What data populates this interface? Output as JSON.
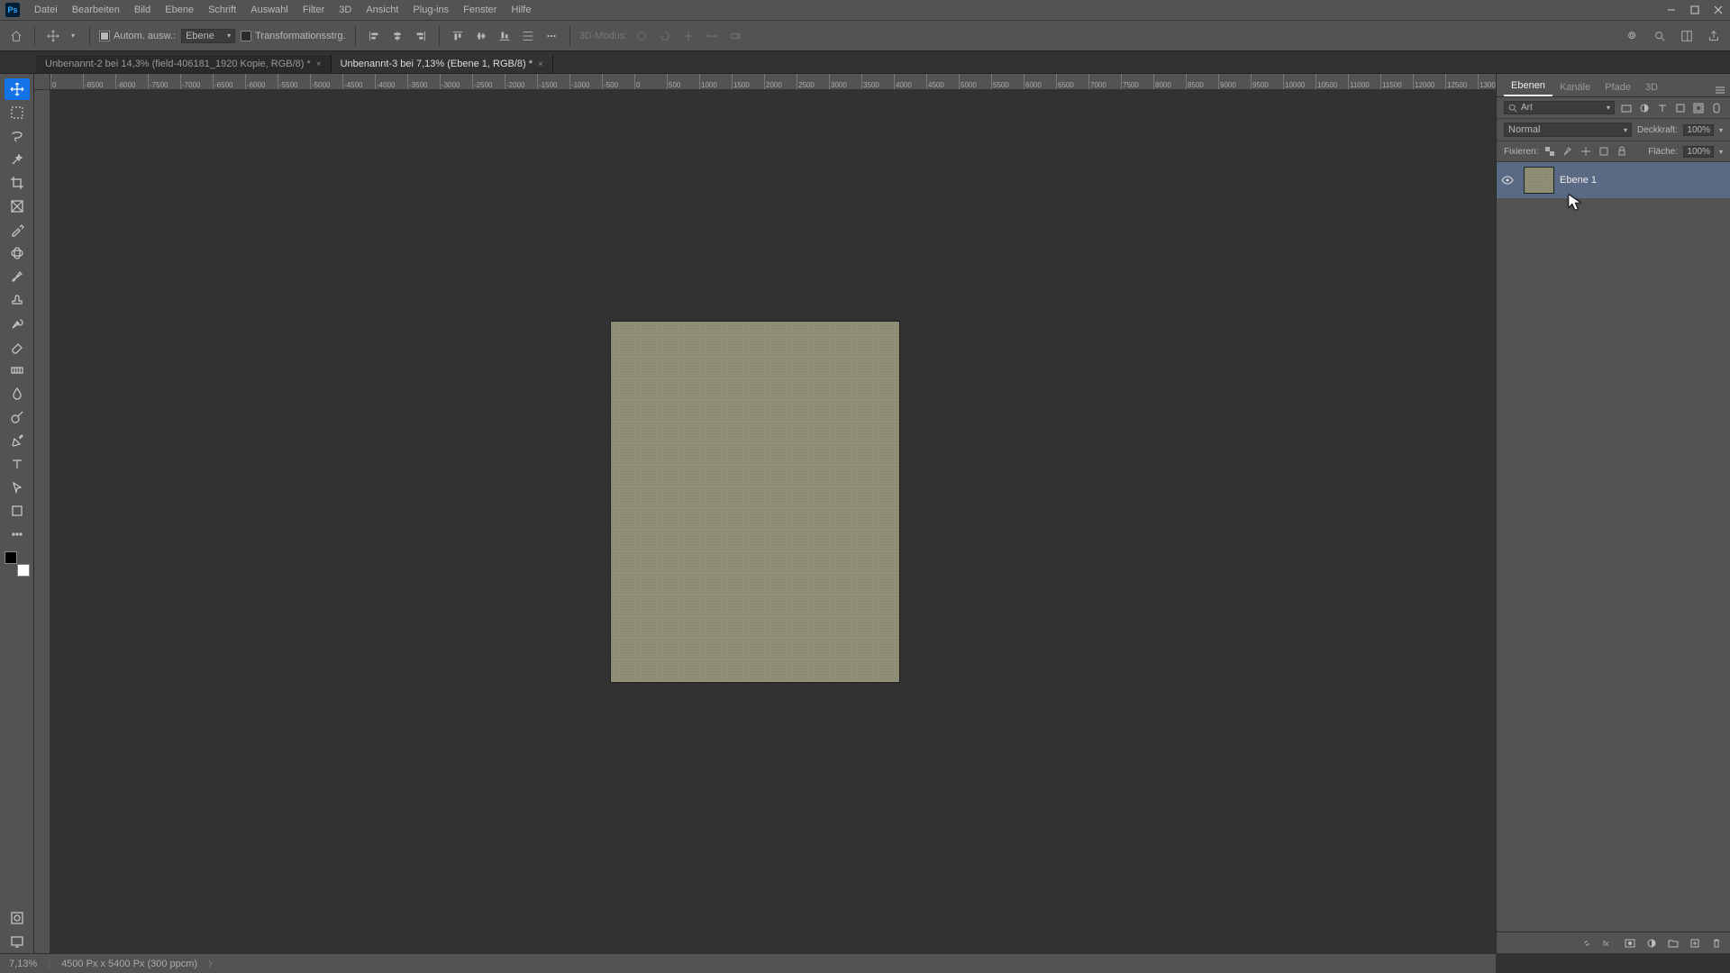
{
  "menu": [
    "Datei",
    "Bearbeiten",
    "Bild",
    "Ebene",
    "Schrift",
    "Auswahl",
    "Filter",
    "3D",
    "Ansicht",
    "Plug-ins",
    "Fenster",
    "Hilfe"
  ],
  "logo": "Ps",
  "optbar": {
    "auto_label": "Autom. ausw.:",
    "target_dropdown": "Ebene",
    "transform_label": "Transformationsstrg.",
    "mode3d": "3D-Modus:"
  },
  "tabs": [
    {
      "label": "Unbenannt-2 bei 14,3% (field-406181_1920 Kopie, RGB/8) *",
      "active": false
    },
    {
      "label": "Unbenannt-3 bei 7,13% (Ebene 1, RGB/8) *",
      "active": true
    }
  ],
  "ruler_h": [
    "0",
    "-8500",
    "-8000",
    "-7500",
    "-7000",
    "-6500",
    "-6000",
    "-5500",
    "-5000",
    "-4500",
    "-4000",
    "-3500",
    "-3000",
    "-2500",
    "-2000",
    "-1500",
    "-1000",
    "-500",
    "0",
    "500",
    "1000",
    "1500",
    "2000",
    "2500",
    "3000",
    "3500",
    "4000",
    "4500",
    "5000",
    "5500",
    "6000",
    "6500",
    "7000",
    "7500",
    "8000",
    "8500",
    "9000",
    "9500",
    "10000",
    "10500",
    "11000",
    "11500",
    "12000",
    "12500",
    "1300"
  ],
  "panels": {
    "tabs": [
      "Ebenen",
      "Kanäle",
      "Pfade",
      "3D"
    ],
    "search_label": "Art",
    "blend": "Normal",
    "opacity_label": "Deckkraft:",
    "opacity_value": "100%",
    "lock_label": "Fixieren:",
    "fill_label": "Fläche:",
    "fill_value": "100%",
    "layer": {
      "name": "Ebene 1"
    }
  },
  "status": {
    "zoom": "7,13%",
    "docinfo": "4500 Px x 5400 Px (300 ppcm)"
  }
}
